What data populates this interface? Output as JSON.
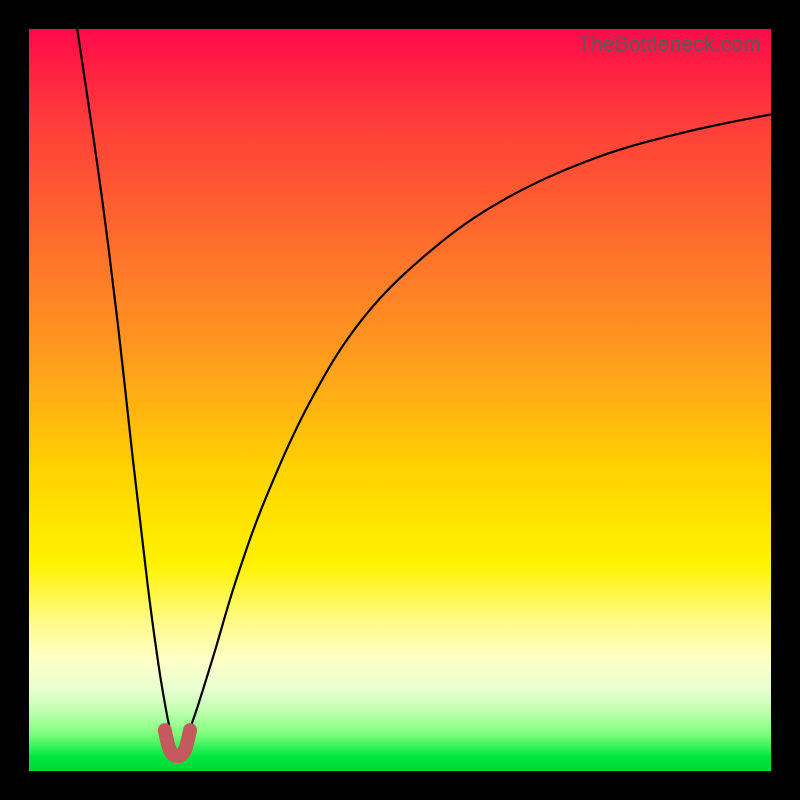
{
  "watermark": "TheBottleneck.com",
  "colors": {
    "frame": "#000000",
    "curve": "#000000",
    "cup_marker": "#c45a5d",
    "gradient_top": "#ff0a4a",
    "gradient_bottom": "#00d835"
  },
  "chart_data": {
    "type": "line",
    "title": "",
    "xlabel": "",
    "ylabel": "",
    "xlim": [
      0,
      100
    ],
    "ylim": [
      0,
      100
    ],
    "grid": false,
    "legend": false,
    "note": "Bottleneck-style V curve; values are percentages of plot area (read off pixel positions). x=0 left edge, y=0 bottom.",
    "minimum": {
      "x": 20,
      "y": 2
    },
    "series": [
      {
        "name": "left-branch",
        "description": "Steep descending arc from top-left corner down to the minimum cup",
        "x": [
          6.5,
          8,
          10,
          12,
          14,
          16,
          17.5,
          18.7,
          19.5,
          20
        ],
        "y": [
          100,
          90,
          76,
          60,
          42,
          25,
          14,
          7,
          3.5,
          2
        ]
      },
      {
        "name": "right-branch",
        "description": "Rising arc from the minimum cup out to the upper-right edge",
        "x": [
          20,
          21,
          22.5,
          25,
          28,
          32,
          38,
          45,
          54,
          64,
          76,
          88,
          100
        ],
        "y": [
          2,
          4,
          8,
          16,
          26,
          37,
          50,
          61,
          70,
          77,
          82.5,
          86,
          88.5
        ]
      },
      {
        "name": "cup-marker",
        "description": "Thick salmon U-shaped marker at the curve minimum",
        "x": [
          18.3,
          19,
          20,
          21,
          21.7
        ],
        "y": [
          5.5,
          2.8,
          2,
          2.8,
          5.5
        ],
        "color": "#c45a5d"
      }
    ]
  }
}
